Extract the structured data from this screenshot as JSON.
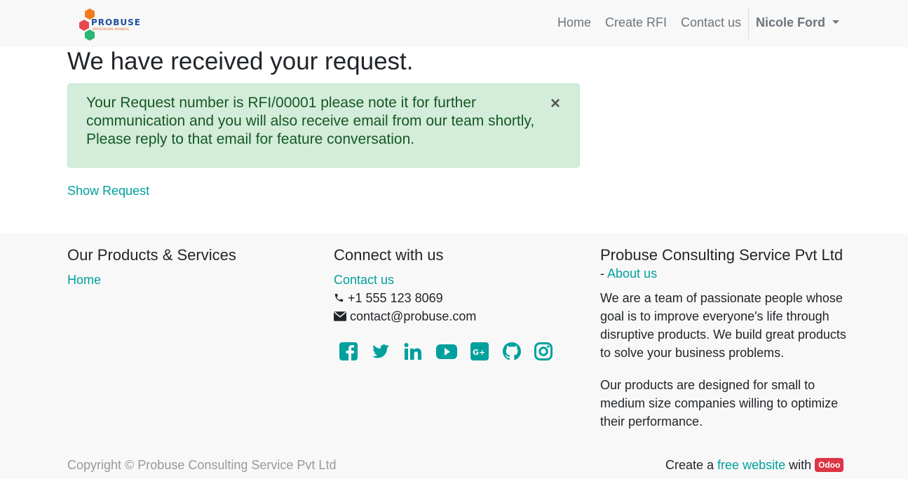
{
  "brand": {
    "name": "PROBUSE",
    "tagline": "PROFESSIONAL BUSINESS"
  },
  "nav": {
    "home": "Home",
    "create_rfi": "Create RFI",
    "contact": "Contact us",
    "user": "Nicole Ford"
  },
  "main": {
    "title": "We have received your request.",
    "alert_text": "Your Request number is RFI/00001 please note it for further communication and you will also receive email from our team shortly, Please reply to that email for feature conversation.",
    "close_glyph": "×",
    "show_request": "Show Request"
  },
  "footer": {
    "products_heading": "Our Products & Services",
    "products_home": "Home",
    "connect_heading": "Connect with us",
    "contact_link": "Contact us",
    "phone": "+1 555 123 8069",
    "email": "contact@probuse.com",
    "company_heading": "Probuse Consulting Service Pvt Ltd",
    "company_dash": "- ",
    "about_link": "About us",
    "about_para1": "We are a team of passionate people whose goal is to improve everyone's life through disruptive products. We build great products to solve your business problems.",
    "about_para2": "Our products are designed for small to medium size companies willing to optimize their performance.",
    "copyright": "Copyright © Probuse Consulting Service Pvt Ltd",
    "credit_prefix": "Create a ",
    "credit_link": "free website",
    "credit_mid": " with ",
    "credit_badge": "Odoo"
  },
  "social_icons": [
    "facebook-icon",
    "twitter-icon",
    "linkedin-icon",
    "youtube-icon",
    "google-plus-icon",
    "github-icon",
    "instagram-icon"
  ],
  "colors": {
    "accent": "#00a09d",
    "alert_bg": "#d4edda",
    "alert_text": "#155724",
    "badge": "#dc3545",
    "navbar_bg": "#f8f8f8"
  }
}
